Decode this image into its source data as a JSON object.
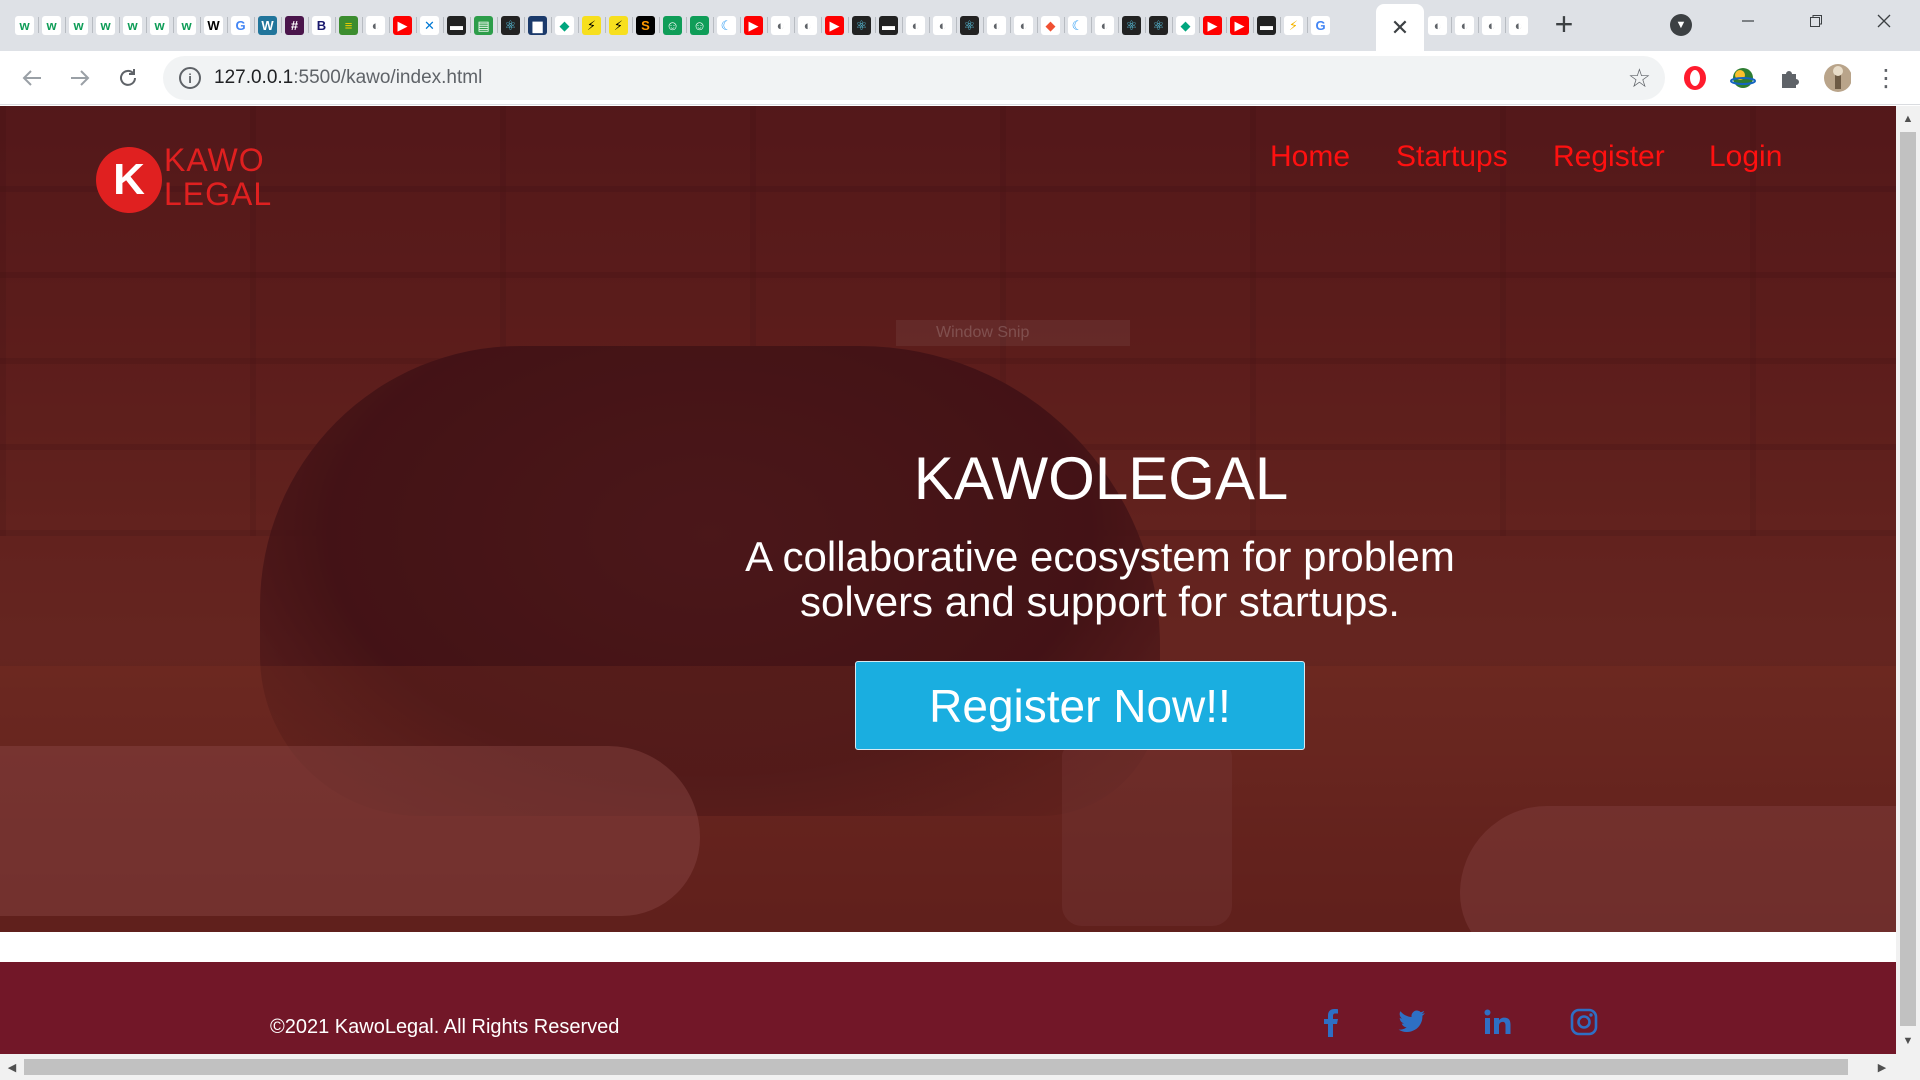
{
  "browser": {
    "address_host": "127.0.0.1",
    "address_path": ":5500/kawo/index.html",
    "close_tab_glyph": "✕",
    "new_tab_glyph": "+",
    "favicons": [
      {
        "g": "w",
        "bg": "#ffffff",
        "fg": "#0f9d58"
      },
      {
        "g": "w",
        "bg": "#ffffff",
        "fg": "#0f9d58"
      },
      {
        "g": "w",
        "bg": "#ffffff",
        "fg": "#0f9d58"
      },
      {
        "g": "w",
        "bg": "#ffffff",
        "fg": "#0f9d58"
      },
      {
        "g": "w",
        "bg": "#ffffff",
        "fg": "#0f9d58"
      },
      {
        "g": "w",
        "bg": "#ffffff",
        "fg": "#0f9d58"
      },
      {
        "g": "w",
        "bg": "#ffffff",
        "fg": "#0f9d58"
      },
      {
        "g": "W",
        "bg": "#ffffff",
        "fg": "#000000"
      },
      {
        "g": "G",
        "bg": "#ffffff",
        "fg": "#4285f4"
      },
      {
        "g": "W",
        "bg": "#21759b",
        "fg": "#ffffff"
      },
      {
        "g": "#",
        "bg": "#4a154b",
        "fg": "#ffffff"
      },
      {
        "g": "B",
        "bg": "#ffffff",
        "fg": "#1a1a6e"
      },
      {
        "g": "≡",
        "bg": "#3c8d2f",
        "fg": "#f5d000"
      },
      {
        "g": "◐",
        "bg": "#ffffff",
        "fg": "#5f6368"
      },
      {
        "g": "▶",
        "bg": "#ff0000",
        "fg": "#ffffff"
      },
      {
        "g": "✕",
        "bg": "#ffffff",
        "fg": "#0078d4"
      },
      {
        "g": "▬",
        "bg": "#222222",
        "fg": "#ffffff"
      },
      {
        "g": "▤",
        "bg": "#2d9d4a",
        "fg": "#ffffff"
      },
      {
        "g": "⚛",
        "bg": "#222222",
        "fg": "#61dafb"
      },
      {
        "g": "▆",
        "bg": "#1b3a6b",
        "fg": "#ffffff"
      },
      {
        "g": "◆",
        "bg": "#ffffff",
        "fg": "#00a67e"
      },
      {
        "g": "⚡",
        "bg": "#f7df1e",
        "fg": "#000000"
      },
      {
        "g": "⚡",
        "bg": "#f7df1e",
        "fg": "#000000"
      },
      {
        "g": "S",
        "bg": "#000000",
        "fg": "#ff9900"
      },
      {
        "g": "☺",
        "bg": "#0f9d58",
        "fg": "#ffffff"
      },
      {
        "g": "☺",
        "bg": "#0f9d58",
        "fg": "#ffffff"
      },
      {
        "g": "☾",
        "bg": "#ffffff",
        "fg": "#2196f3"
      },
      {
        "g": "▶",
        "bg": "#ff0000",
        "fg": "#ffffff"
      },
      {
        "g": "◐",
        "bg": "#ffffff",
        "fg": "#5f6368"
      },
      {
        "g": "◐",
        "bg": "#ffffff",
        "fg": "#5f6368"
      },
      {
        "g": "▶",
        "bg": "#ff0000",
        "fg": "#ffffff"
      },
      {
        "g": "⚛",
        "bg": "#222222",
        "fg": "#61dafb"
      },
      {
        "g": "▬",
        "bg": "#222222",
        "fg": "#ffffff"
      },
      {
        "g": "◐",
        "bg": "#ffffff",
        "fg": "#5f6368"
      },
      {
        "g": "◐",
        "bg": "#ffffff",
        "fg": "#5f6368"
      },
      {
        "g": "⚛",
        "bg": "#222222",
        "fg": "#61dafb"
      },
      {
        "g": "◐",
        "bg": "#ffffff",
        "fg": "#5f6368"
      },
      {
        "g": "◐",
        "bg": "#ffffff",
        "fg": "#5f6368"
      },
      {
        "g": "◆",
        "bg": "#ffffff",
        "fg": "#f05032"
      },
      {
        "g": "☾",
        "bg": "#ffffff",
        "fg": "#2196f3"
      },
      {
        "g": "◐",
        "bg": "#ffffff",
        "fg": "#5f6368"
      },
      {
        "g": "⚛",
        "bg": "#222222",
        "fg": "#61dafb"
      },
      {
        "g": "⚛",
        "bg": "#222222",
        "fg": "#61dafb"
      },
      {
        "g": "◆",
        "bg": "#ffffff",
        "fg": "#00a67e"
      },
      {
        "g": "▶",
        "bg": "#ff0000",
        "fg": "#ffffff"
      },
      {
        "g": "▶",
        "bg": "#ff0000",
        "fg": "#ffffff"
      },
      {
        "g": "▬",
        "bg": "#222222",
        "fg": "#ffffff"
      },
      {
        "g": "⚡",
        "bg": "#ffffff",
        "fg": "#f4b400"
      },
      {
        "g": "G",
        "bg": "#ffffff",
        "fg": "#4285f4"
      }
    ],
    "favicons_after": [
      {
        "g": "◐",
        "bg": "#ffffff",
        "fg": "#5f6368"
      },
      {
        "g": "◐",
        "bg": "#ffffff",
        "fg": "#5f6368"
      },
      {
        "g": "◐",
        "bg": "#ffffff",
        "fg": "#5f6368"
      },
      {
        "g": "◐",
        "bg": "#ffffff",
        "fg": "#5f6368"
      }
    ]
  },
  "site": {
    "logo_mark": "K",
    "logo_line1": "KAWO",
    "logo_line2": "LEGAL",
    "nav": [
      "Home",
      "Startups",
      "Register",
      "Login"
    ],
    "hero_title": "KAWOLEGAL",
    "hero_subtitle": "A collaborative ecosystem for problem solvers and support for startups.",
    "cta_label": "Register Now!!",
    "ghost_overlay": "Window Snip",
    "footer_copyright": "©2021 KawoLegal. All Rights Reserved",
    "social": [
      {
        "icon": "facebook-icon",
        "glyph": "f"
      },
      {
        "icon": "twitter-icon",
        "glyph": "🐦"
      },
      {
        "icon": "linkedin-icon",
        "glyph": "in"
      },
      {
        "icon": "instagram-icon",
        "glyph": "◎"
      }
    ]
  },
  "colors": {
    "nav_link": "#ff1010",
    "logo_red": "#e02020",
    "cta_bg": "#1aaee0",
    "footer_bg": "#721728",
    "social_icon": "#2e6fc4"
  }
}
